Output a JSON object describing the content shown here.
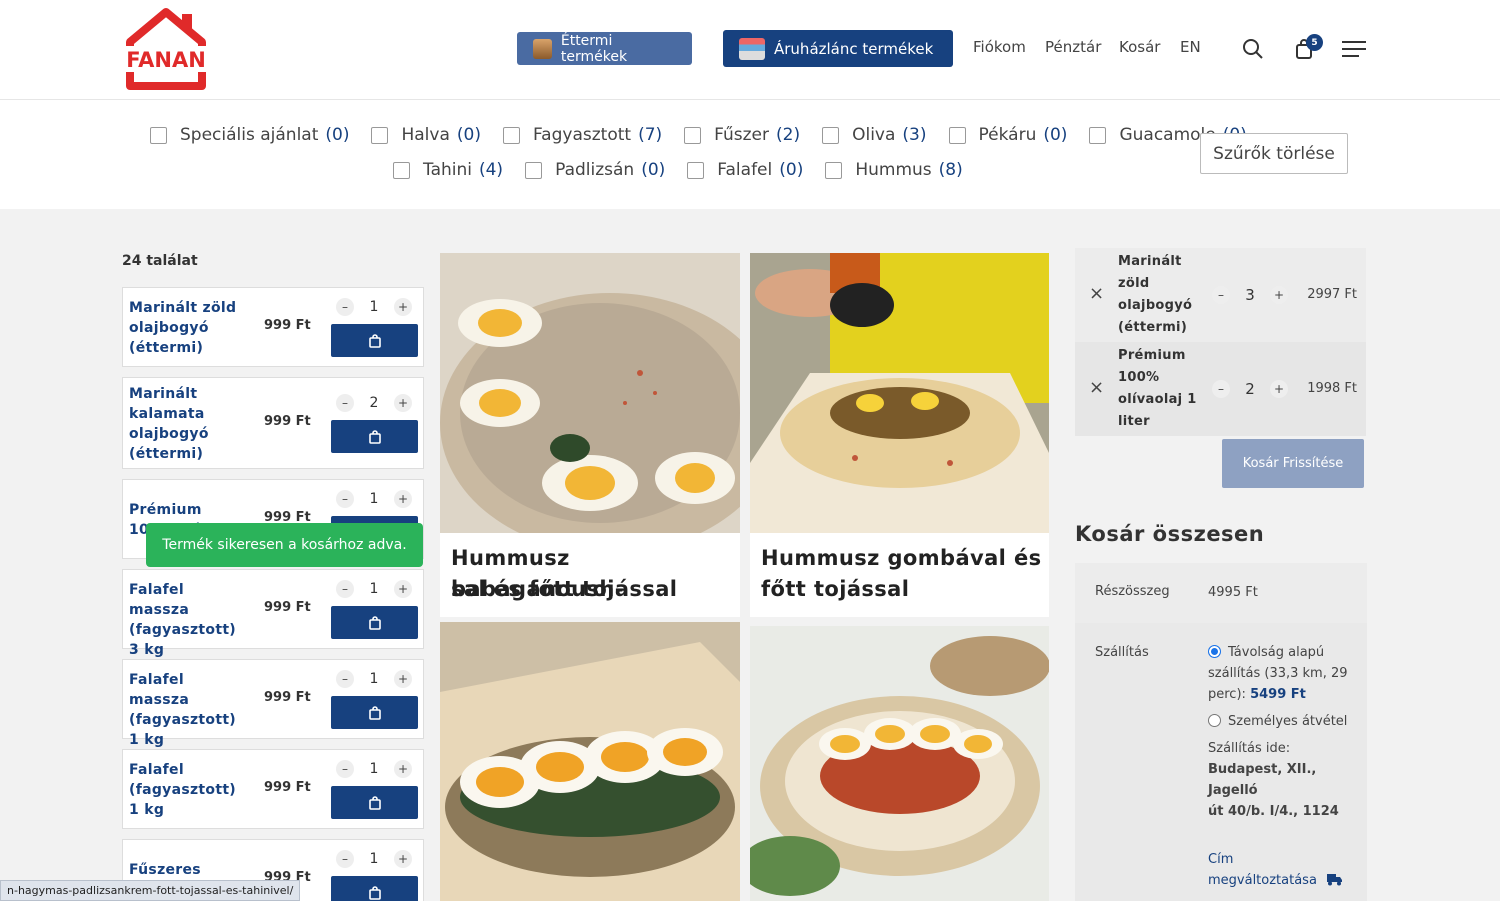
{
  "header": {
    "logo_text": "FANAN",
    "nav_restaurant": "Éttermi termékek",
    "nav_chain": "Áruházlánc termékek",
    "nav_account": "Fiókom",
    "nav_checkout": "Pénztár",
    "nav_cart": "Kosár",
    "nav_lang": "EN",
    "cart_count": "5"
  },
  "filters": {
    "row1": [
      {
        "label": "Speciális ajánlat",
        "count": "(0)"
      },
      {
        "label": "Halva",
        "count": "(0)"
      },
      {
        "label": "Fagyasztott",
        "count": "(7)"
      },
      {
        "label": "Fűszer",
        "count": "(2)"
      },
      {
        "label": "Oliva",
        "count": "(3)"
      },
      {
        "label": "Pékáru",
        "count": "(0)"
      },
      {
        "label": "Guacamole",
        "count": "(0)"
      }
    ],
    "row2": [
      {
        "label": "Tahini",
        "count": "(4)"
      },
      {
        "label": "Padlizsán",
        "count": "(0)"
      },
      {
        "label": "Falafel",
        "count": "(0)"
      },
      {
        "label": "Hummus",
        "count": "(8)"
      }
    ],
    "clear_label": "Szűrők törlése"
  },
  "results_label": "24 találat",
  "products": [
    {
      "name": "Marinált zöld olajbogyó (éttermi)",
      "price": "999 Ft",
      "qty": "1"
    },
    {
      "name": "Marinált kalamata olajbogyó (éttermi)",
      "price": "999 Ft",
      "qty": "2"
    },
    {
      "name": "Prémium 100% olí…",
      "price": "999 Ft",
      "qty": "1"
    },
    {
      "name": "Falafel massza (fagyasztott) 3 kg",
      "price": "999 Ft",
      "qty": "1"
    },
    {
      "name": "Falafel massza (fagyasztott) 1 kg",
      "price": "999 Ft",
      "qty": "1"
    },
    {
      "name": "Falafel (fagyasztott) 1 kg",
      "price": "999 Ft",
      "qty": "1"
    },
    {
      "name": "Fűszeres csicseriborsó",
      "price": "999 Ft",
      "qty": "1"
    }
  ],
  "toast": "Termék sikeresen a kosárhoz adva.",
  "status_url": "n-hagymas-padlizsankrem-fott-tojassal-es-tahinivel/",
  "grid": [
    {
      "title_line1": "Hummusz babaganoush-",
      "title_line2": "sal és főtt tojással"
    },
    {
      "title_line1": "Hummusz gombával és",
      "title_line2": "főtt tojással"
    }
  ],
  "cart": {
    "items": [
      {
        "name_lines": [
          "Marinált",
          "zöld",
          "olajbogyó",
          "(éttermi)"
        ],
        "qty": "3",
        "price": "2997 Ft"
      },
      {
        "name_lines": [
          "Prémium",
          "100%",
          "olívaolaj 1",
          "liter"
        ],
        "qty": "2",
        "price": "1998 Ft"
      }
    ],
    "update_label": "Kosár Frissítése",
    "totals_title": "Kosár összesen",
    "subtotal_label": "Részösszeg",
    "subtotal_value": "4995 Ft",
    "shipping_label": "Szállítás",
    "shipping_opt1_line1": "Távolság alapú",
    "shipping_opt1_line2": "szállítás (33,3 km, 29",
    "shipping_opt1_line3": "perc):",
    "shipping_opt1_price": "5499 Ft",
    "shipping_opt2": "Személyes átvétel",
    "ship_to_label": "Szállítás ide:",
    "address_line1": "Budapest, XII., Jagelló",
    "address_line2": "út 40/b. I/4., 1124",
    "change_line1": "Cím",
    "change_line2": "megváltoztatása"
  },
  "colors": {
    "brand": "#17417f",
    "logo_red": "#e02a2a",
    "toast": "#2bb35a"
  }
}
